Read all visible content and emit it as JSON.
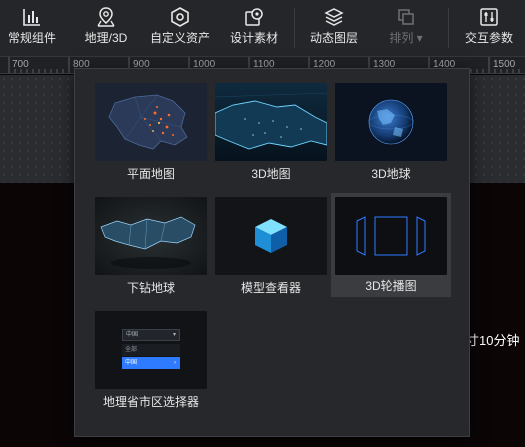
{
  "toolbar": {
    "items": [
      {
        "label": "常规组件",
        "icon": "bar-chart-icon"
      },
      {
        "label": "地理/3D",
        "icon": "map-pin-icon"
      },
      {
        "label": "自定义资产",
        "icon": "hexagon-icon"
      },
      {
        "label": "设计素材",
        "icon": "design-material-icon"
      },
      {
        "label": "动态图层",
        "icon": "layers-icon"
      },
      {
        "label": "排列 ▾",
        "icon": "arrange-icon",
        "disabled": true
      },
      {
        "label": "交互参数",
        "icon": "sliders-icon"
      }
    ]
  },
  "ruler": {
    "labels": [
      "700",
      "800",
      "900",
      "1000",
      "1100",
      "1200",
      "1300",
      "1400",
      "1500"
    ]
  },
  "canvas": {
    "text": "寸10分钟"
  },
  "popup": {
    "items": [
      {
        "label": "平面地图",
        "thumb": "flat-map"
      },
      {
        "label": "3D地图",
        "thumb": "3d-map"
      },
      {
        "label": "3D地球",
        "thumb": "3d-globe"
      },
      {
        "label": "下钻地球",
        "thumb": "drilldown"
      },
      {
        "label": "模型查看器",
        "thumb": "model-viewer"
      },
      {
        "label": "3D轮播图",
        "thumb": "carousel",
        "selected": true
      },
      {
        "label": "地理省市区选择器",
        "thumb": "selector"
      }
    ],
    "selector_thumb": {
      "input_text": "中国",
      "option_1": "全部",
      "option_2": "中国"
    }
  },
  "colors": {
    "toolbar_bg": "#242629",
    "popup_bg": "#26282c",
    "accent_blue": "#2f7bff",
    "text": "#e6e6e6"
  }
}
